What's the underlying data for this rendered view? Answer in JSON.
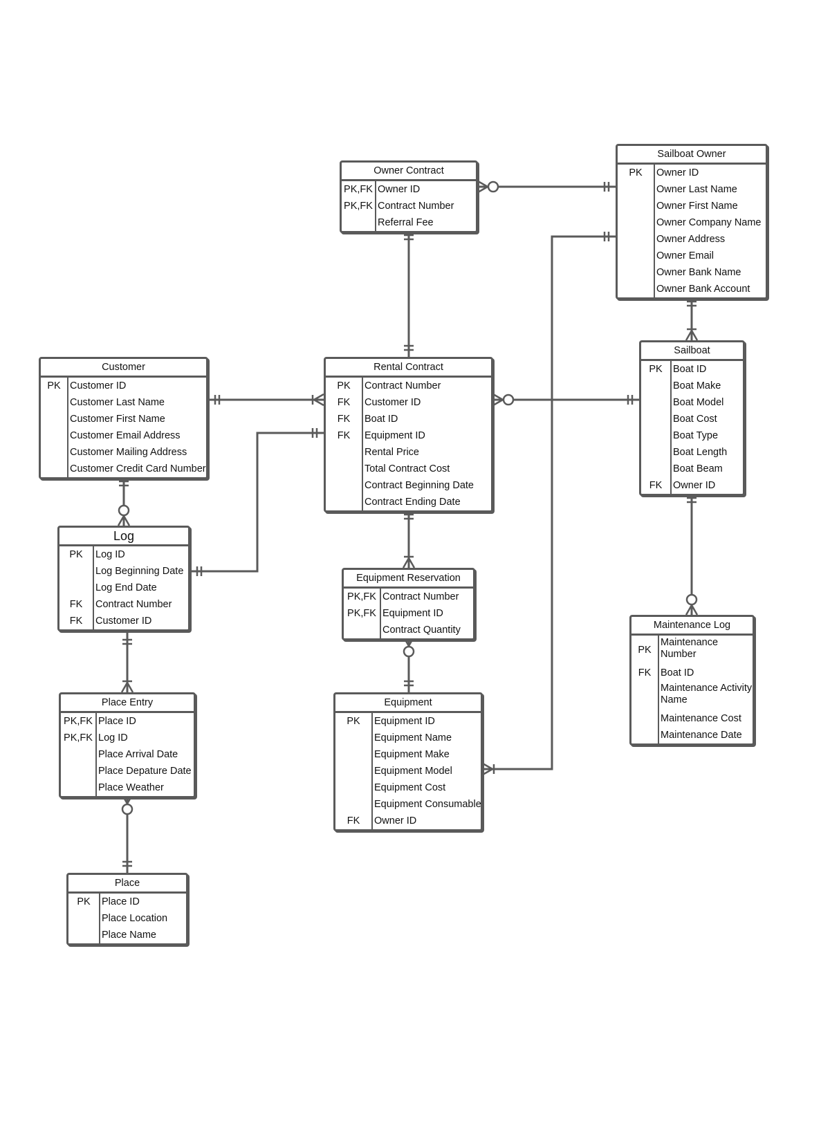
{
  "diagram": {
    "type": "Entity Relationship Diagram (crow's foot notation)",
    "colors": {
      "line": "#5a5a5a",
      "background": "#ffffff",
      "text": "#111111"
    }
  },
  "entities": {
    "owner_contract": {
      "title": "Owner Contract",
      "rows": [
        {
          "key": "PK,FK",
          "attr": "Owner ID"
        },
        {
          "key": "PK,FK",
          "attr": "Contract Number"
        },
        {
          "key": "",
          "attr": "Referral Fee"
        }
      ]
    },
    "sailboat_owner": {
      "title": "Sailboat Owner",
      "rows": [
        {
          "key": "PK",
          "attr": "Owner ID"
        },
        {
          "key": "",
          "attr": "Owner Last Name"
        },
        {
          "key": "",
          "attr": "Owner First Name"
        },
        {
          "key": "",
          "attr": "Owner Company Name"
        },
        {
          "key": "",
          "attr": "Owner Address"
        },
        {
          "key": "",
          "attr": "Owner Email"
        },
        {
          "key": "",
          "attr": "Owner Bank Name"
        },
        {
          "key": "",
          "attr": "Owner Bank Account"
        }
      ]
    },
    "customer": {
      "title": "Customer",
      "rows": [
        {
          "key": "PK",
          "attr": "Customer ID"
        },
        {
          "key": "",
          "attr": "Customer Last Name"
        },
        {
          "key": "",
          "attr": "Customer First Name"
        },
        {
          "key": "",
          "attr": "Customer Email Address"
        },
        {
          "key": "",
          "attr": "Customer Mailing Address"
        },
        {
          "key": "",
          "attr": "Customer Credit Card Number"
        }
      ]
    },
    "rental_contract": {
      "title": "Rental Contract",
      "rows": [
        {
          "key": "PK",
          "attr": "Contract Number"
        },
        {
          "key": "FK",
          "attr": "Customer ID"
        },
        {
          "key": "FK",
          "attr": "Boat ID"
        },
        {
          "key": "FK",
          "attr": "Equipment ID"
        },
        {
          "key": "",
          "attr": "Rental Price"
        },
        {
          "key": "",
          "attr": "Total Contract Cost"
        },
        {
          "key": "",
          "attr": "Contract Beginning Date"
        },
        {
          "key": "",
          "attr": "Contract Ending Date"
        }
      ]
    },
    "sailboat": {
      "title": "Sailboat",
      "rows": [
        {
          "key": "PK",
          "attr": "Boat ID"
        },
        {
          "key": "",
          "attr": "Boat Make"
        },
        {
          "key": "",
          "attr": "Boat Model"
        },
        {
          "key": "",
          "attr": "Boat Cost"
        },
        {
          "key": "",
          "attr": "Boat Type"
        },
        {
          "key": "",
          "attr": "Boat Length"
        },
        {
          "key": "",
          "attr": "Boat Beam"
        },
        {
          "key": "FK",
          "attr": "Owner ID"
        }
      ]
    },
    "log": {
      "title": "Log",
      "rows": [
        {
          "key": "PK",
          "attr": "Log ID"
        },
        {
          "key": "",
          "attr": "Log Beginning Date"
        },
        {
          "key": "",
          "attr": "Log End Date"
        },
        {
          "key": "FK",
          "attr": "Contract Number"
        },
        {
          "key": "FK",
          "attr": "Customer ID"
        }
      ]
    },
    "equipment_reservation": {
      "title": "Equipment Reservation",
      "rows": [
        {
          "key": "PK,FK",
          "attr": "Contract Number"
        },
        {
          "key": "PK,FK",
          "attr": "Equipment ID"
        },
        {
          "key": "",
          "attr": "Contract Quantity"
        }
      ]
    },
    "maintenance_log": {
      "title": "Maintenance Log",
      "rows": [
        {
          "key": "PK",
          "attr": "Maintenance Number"
        },
        {
          "key": "FK",
          "attr": "Boat ID"
        },
        {
          "key": "",
          "attr": "Maintenance Activity Name"
        },
        {
          "key": "",
          "attr": "Maintenance Cost"
        },
        {
          "key": "",
          "attr": "Maintenance Date"
        }
      ]
    },
    "place_entry": {
      "title": "Place Entry",
      "rows": [
        {
          "key": "PK,FK",
          "attr": "Place ID"
        },
        {
          "key": "PK,FK",
          "attr": "Log ID"
        },
        {
          "key": "",
          "attr": "Place Arrival Date"
        },
        {
          "key": "",
          "attr": "Place Depature Date"
        },
        {
          "key": "",
          "attr": "Place Weather"
        }
      ]
    },
    "equipment": {
      "title": "Equipment",
      "rows": [
        {
          "key": "PK",
          "attr": "Equipment ID"
        },
        {
          "key": "",
          "attr": "Equipment Name"
        },
        {
          "key": "",
          "attr": "Equipment Make"
        },
        {
          "key": "",
          "attr": "Equipment Model"
        },
        {
          "key": "",
          "attr": "Equipment Cost"
        },
        {
          "key": "",
          "attr": "Equipment Consumable"
        },
        {
          "key": "FK",
          "attr": "Owner ID"
        }
      ]
    },
    "place": {
      "title": "Place",
      "rows": [
        {
          "key": "PK",
          "attr": "Place ID"
        },
        {
          "key": "",
          "attr": "Place Location"
        },
        {
          "key": "",
          "attr": "Place Name"
        }
      ]
    }
  },
  "relationships": [
    {
      "from": "owner_contract",
      "from_card": "zero-or-many",
      "to": "sailboat_owner",
      "to_card": "one-and-only-one"
    },
    {
      "from": "owner_contract",
      "from_card": "one-and-only-one",
      "to": "rental_contract",
      "to_card": "one-and-only-one"
    },
    {
      "from": "customer",
      "from_card": "one-and-only-one",
      "to": "rental_contract",
      "to_card": "one-or-many"
    },
    {
      "from": "rental_contract",
      "from_card": "zero-or-many",
      "to": "sailboat",
      "to_card": "one-and-only-one"
    },
    {
      "from": "sailboat_owner",
      "from_card": "one-and-only-one",
      "to": "sailboat",
      "to_card": "one-or-many"
    },
    {
      "from": "sailboat_owner",
      "from_card": "one-and-only-one",
      "to": "equipment",
      "to_card": "one-or-many"
    },
    {
      "from": "rental_contract",
      "from_card": "one-and-only-one",
      "to": "log",
      "to_card": "one-and-only-one"
    },
    {
      "from": "customer",
      "from_card": "one-and-only-one",
      "to": "log",
      "to_card": "zero-or-many"
    },
    {
      "from": "rental_contract",
      "from_card": "one-and-only-one",
      "to": "equipment_reservation",
      "to_card": "one-or-many"
    },
    {
      "from": "equipment_reservation",
      "from_card": "zero-or-many",
      "to": "equipment",
      "to_card": "one-and-only-one"
    },
    {
      "from": "sailboat",
      "from_card": "one-and-only-one",
      "to": "maintenance_log",
      "to_card": "zero-or-many"
    },
    {
      "from": "log",
      "from_card": "one-and-only-one",
      "to": "place_entry",
      "to_card": "one-or-many"
    },
    {
      "from": "place_entry",
      "from_card": "zero-or-many",
      "to": "place",
      "to_card": "one-and-only-one"
    }
  ]
}
